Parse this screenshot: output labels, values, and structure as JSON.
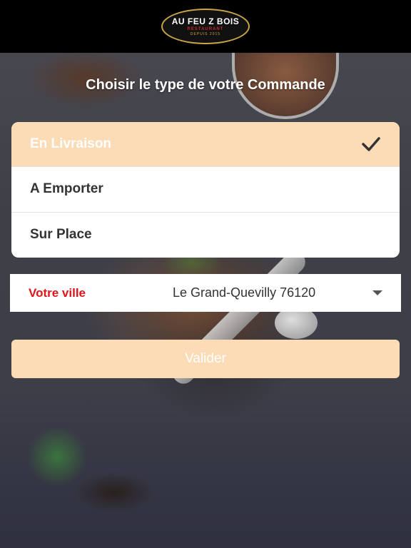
{
  "header": {
    "logo_main": "AU FEU Z BOIS",
    "logo_sub": "RESTAURANT",
    "logo_year": "DEPUIS 2015"
  },
  "heading": "Choisir le type de votre Commande",
  "order_types": [
    {
      "label": "En Livraison",
      "selected": true
    },
    {
      "label": "A Emporter",
      "selected": false
    },
    {
      "label": "Sur Place",
      "selected": false
    }
  ],
  "city": {
    "label": "Votre ville",
    "value": "Le Grand-Quevilly 76120"
  },
  "validate_label": "Valider",
  "colors": {
    "accent": "#fcdcb6",
    "city_label": "#e0141b",
    "header_bg": "#000000"
  }
}
